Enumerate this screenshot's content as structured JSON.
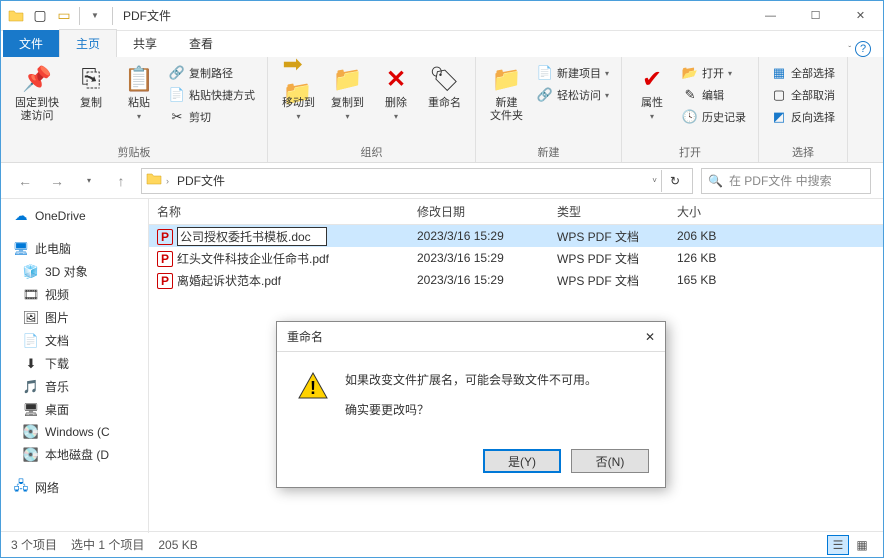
{
  "window": {
    "title": "PDF文件"
  },
  "tabs": {
    "file": "文件",
    "home": "主页",
    "share": "共享",
    "view": "查看"
  },
  "ribbon": {
    "pin": "固定到快\n速访问",
    "copy": "复制",
    "paste": "粘贴",
    "copypath": "复制路径",
    "pasteshortcut": "粘贴快捷方式",
    "cut": "剪切",
    "group_clipboard": "剪贴板",
    "moveto": "移动到",
    "copyto": "复制到",
    "delete": "删除",
    "rename": "重命名",
    "group_organize": "组织",
    "newfolder": "新建\n文件夹",
    "newitem": "新建项目",
    "easyaccess": "轻松访问",
    "group_new": "新建",
    "properties": "属性",
    "open": "打开",
    "edit": "编辑",
    "history": "历史记录",
    "group_open": "打开",
    "selectall": "全部选择",
    "selectnone": "全部取消",
    "invertsel": "反向选择",
    "group_select": "选择"
  },
  "addressbar": {
    "path": "PDF文件",
    "search_placeholder": "在 PDF文件 中搜索"
  },
  "sidebar": {
    "onedrive": "OneDrive",
    "thispc": "此电脑",
    "items": [
      "3D 对象",
      "视频",
      "图片",
      "文档",
      "下载",
      "音乐",
      "桌面",
      "Windows (C",
      "本地磁盘 (D"
    ],
    "network": "网络"
  },
  "columns": {
    "name": "名称",
    "date": "修改日期",
    "type": "类型",
    "size": "大小"
  },
  "files": [
    {
      "name": "公司授权委托书模板.doc",
      "date": "2023/3/16 15:29",
      "type": "WPS PDF 文档",
      "size": "206 KB",
      "selected": true,
      "renaming": true
    },
    {
      "name": "红头文件科技企业任命书.pdf",
      "date": "2023/3/16 15:29",
      "type": "WPS PDF 文档",
      "size": "126 KB"
    },
    {
      "name": "离婚起诉状范本.pdf",
      "date": "2023/3/16 15:29",
      "type": "WPS PDF 文档",
      "size": "165 KB"
    }
  ],
  "dialog": {
    "title": "重命名",
    "line1": "如果改变文件扩展名，可能会导致文件不可用。",
    "line2": "确实要更改吗？",
    "yes": "是(Y)",
    "no": "否(N)"
  },
  "statusbar": {
    "count": "3 个项目",
    "selected": "选中 1 个项目",
    "size": "205 KB"
  }
}
